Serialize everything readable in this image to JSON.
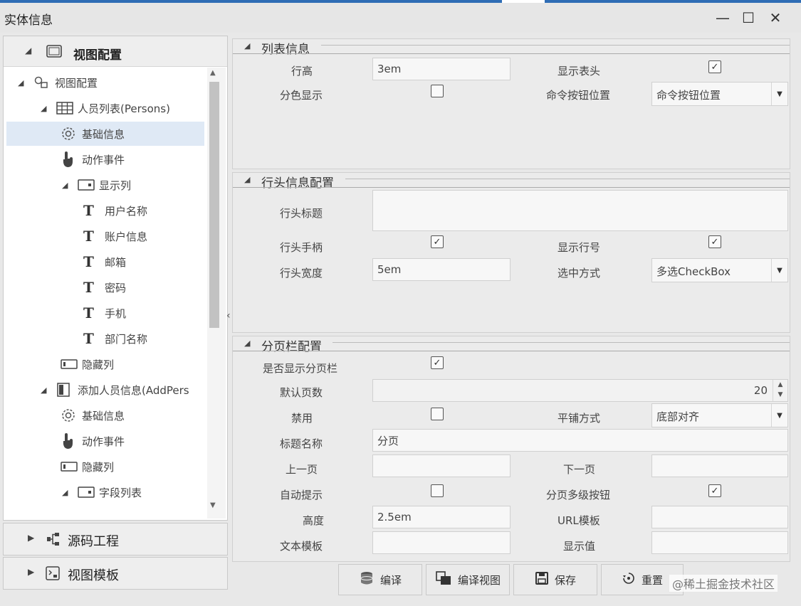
{
  "window": {
    "title": "实体信息",
    "controls": {
      "minimize": "—",
      "maximize": "☐",
      "close": "✕"
    }
  },
  "left_panel": {
    "header_label": "视图配置",
    "tree": [
      {
        "label": "视图配置",
        "icon": "link-icon",
        "twisty": "◢"
      },
      {
        "label": "人员列表(Persons)",
        "icon": "table-icon",
        "twisty": "◢"
      },
      {
        "label": "基础信息",
        "icon": "gear-icon",
        "selected": true
      },
      {
        "label": "动作事件",
        "icon": "hand-pointer-icon"
      },
      {
        "label": "显示列",
        "icon": "column-icon",
        "twisty": "◢"
      },
      {
        "label": "用户名称",
        "icon": "text-icon"
      },
      {
        "label": "账户信息",
        "icon": "text-icon"
      },
      {
        "label": "邮箱",
        "icon": "text-icon"
      },
      {
        "label": "密码",
        "icon": "text-icon"
      },
      {
        "label": "手机",
        "icon": "text-icon"
      },
      {
        "label": "部门名称",
        "icon": "text-icon"
      },
      {
        "label": "隐藏列",
        "icon": "hidden-column-icon"
      },
      {
        "label": "添加人员信息(AddPers",
        "icon": "form-icon",
        "twisty": "◢"
      },
      {
        "label": "基础信息",
        "icon": "gear-icon"
      },
      {
        "label": "动作事件",
        "icon": "hand-pointer-icon"
      },
      {
        "label": "隐藏列",
        "icon": "hidden-column-icon"
      },
      {
        "label": "字段列表",
        "icon": "column-icon",
        "twisty": "◢"
      }
    ]
  },
  "accordion": [
    {
      "label": "源码工程",
      "icon": "project-icon"
    },
    {
      "label": "视图模板",
      "icon": "template-icon"
    }
  ],
  "list_info": {
    "title": "列表信息",
    "row_height_label": "行高",
    "row_height_value": "3em",
    "show_header_label": "显示表头",
    "show_header": true,
    "alt_color_label": "分色显示",
    "alt_color": false,
    "cmd_pos_label": "命令按钮位置",
    "cmd_pos_value": "命令按钮位置"
  },
  "row_header": {
    "title": "行头信息配置",
    "title_label": "行头标题",
    "title_value": "",
    "handle_label": "行头手柄",
    "handle": true,
    "show_rownum_label": "显示行号",
    "show_rownum": true,
    "width_label": "行头宽度",
    "width_value": "5em",
    "select_mode_label": "选中方式",
    "select_mode_value": "多选CheckBox"
  },
  "pager": {
    "title": "分页栏配置",
    "show_pager_label": "是否显示分页栏",
    "show_pager": true,
    "default_pages_label": "默认页数",
    "default_pages_value": "20",
    "disabled_label": "禁用",
    "disabled": false,
    "tile_label": "平铺方式",
    "tile_value": "底部对齐",
    "caption_label": "标题名称",
    "caption_value": "分页",
    "prev_label": "上一页",
    "prev_value": "",
    "next_label": "下一页",
    "next_value": "",
    "auto_hint_label": "自动提示",
    "auto_hint": false,
    "multi_btn_label": "分页多级按钮",
    "multi_btn": true,
    "height_label": "高度",
    "height_value": "2.5em",
    "url_tpl_label": "URL模板",
    "url_tpl_value": "",
    "text_tpl_label": "文本模板",
    "text_tpl_value": "",
    "display_label": "显示值",
    "display_value": ""
  },
  "footer": {
    "compile": "编译",
    "compile_view": "编译视图",
    "save": "保存",
    "reset": "重置"
  },
  "watermark": "@稀土掘金技术社区"
}
